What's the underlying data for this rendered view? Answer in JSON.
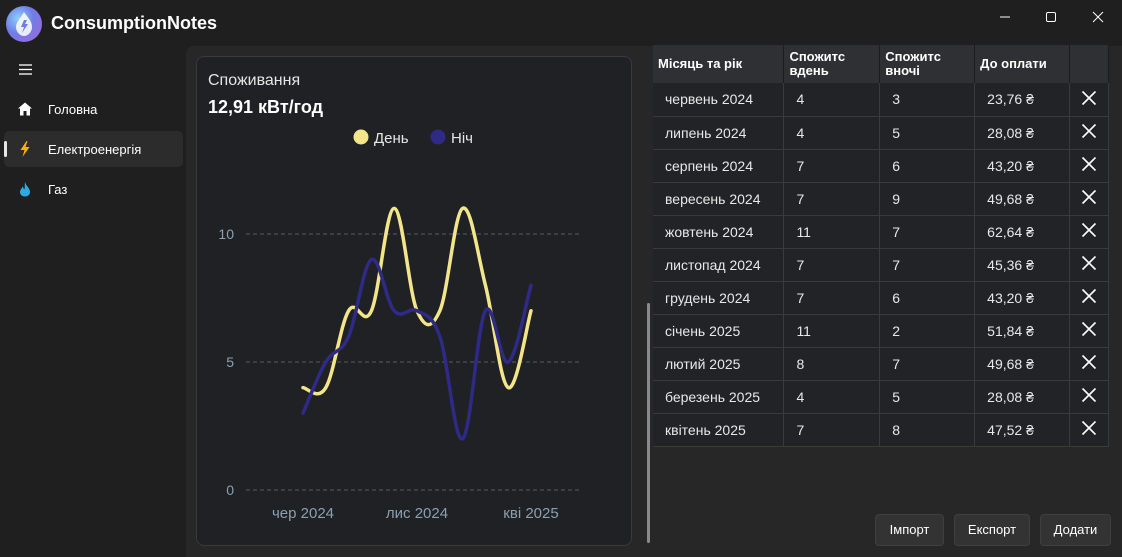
{
  "app": {
    "title": "ConsumptionNotes"
  },
  "nav": {
    "items": [
      {
        "label": "Головна",
        "icon": "home-icon",
        "active": false
      },
      {
        "label": "Електроенергія",
        "icon": "lightning-icon",
        "active": true
      },
      {
        "label": "Газ",
        "icon": "flame-icon",
        "active": false
      }
    ]
  },
  "card": {
    "title": "Споживання",
    "value": "12,91 кВт/год"
  },
  "chart_data": {
    "type": "line",
    "categories": [
      "червень 2024",
      "липень 2024",
      "серпень 2024",
      "вересень 2024",
      "жовтень 2024",
      "листопад 2024",
      "грудень 2024",
      "січень 2025",
      "лютий 2025",
      "березень 2025",
      "квітень 2025"
    ],
    "series": [
      {
        "name": "День",
        "color": "#f2e58a",
        "values": [
          4,
          4,
          7,
          7,
          11,
          7,
          7,
          11,
          8,
          4,
          7
        ]
      },
      {
        "name": "Ніч",
        "color": "#2e2a86",
        "values": [
          3,
          5,
          6,
          9,
          7,
          7,
          6,
          2,
          7,
          5,
          8
        ]
      }
    ],
    "x_tick_labels": [
      "чер 2024",
      "лис 2024",
      "кві 2025"
    ],
    "y_ticks": [
      0,
      5,
      10
    ],
    "ylim": [
      0,
      11
    ],
    "legend": "top",
    "grid": true
  },
  "table": {
    "headers": [
      "Місяць та рік",
      "Спожитс вдень",
      "Спожитс вночі",
      "До оплати",
      ""
    ],
    "rows": [
      [
        "червень 2024",
        "4",
        "3",
        "23,76 ₴"
      ],
      [
        "липень 2024",
        "4",
        "5",
        "28,08 ₴"
      ],
      [
        "серпень 2024",
        "7",
        "6",
        "43,20 ₴"
      ],
      [
        "вересень 2024",
        "7",
        "9",
        "49,68 ₴"
      ],
      [
        "жовтень 2024",
        "11",
        "7",
        "62,64 ₴"
      ],
      [
        "листопад 2024",
        "7",
        "7",
        "45,36 ₴"
      ],
      [
        "грудень 2024",
        "7",
        "6",
        "43,20 ₴"
      ],
      [
        "січень 2025",
        "11",
        "2",
        "51,84 ₴"
      ],
      [
        "лютий 2025",
        "8",
        "7",
        "49,68 ₴"
      ],
      [
        "березень 2025",
        "4",
        "5",
        "28,08 ₴"
      ],
      [
        "квітень 2025",
        "7",
        "8",
        "47,52 ₴"
      ]
    ]
  },
  "actions": {
    "import": "Імпорт",
    "export": "Експорт",
    "add": "Додати"
  }
}
